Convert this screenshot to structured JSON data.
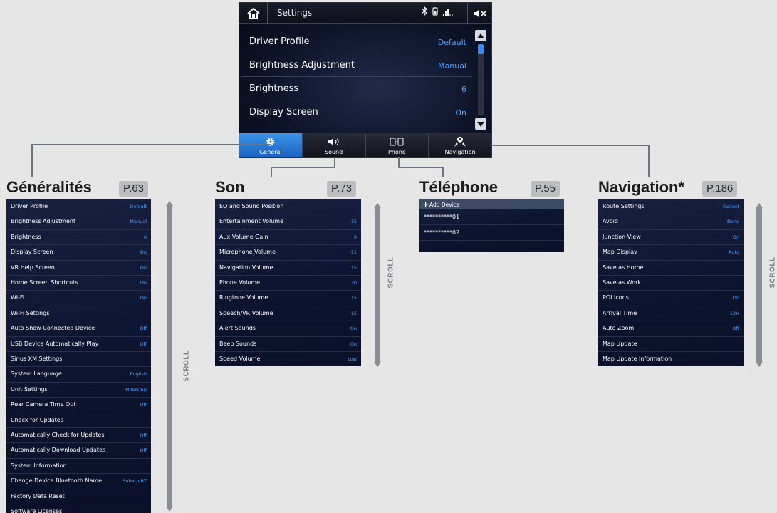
{
  "screen": {
    "title": "Settings",
    "icons": [
      "home-icon",
      "bluetooth-icon",
      "phone-battery-icon",
      "signal-icon",
      "mute-icon"
    ],
    "rows": [
      {
        "label": "Driver Profile",
        "value": "Default"
      },
      {
        "label": "Brightness Adjustment",
        "value": "Manual"
      },
      {
        "label": "Brightness",
        "value": "6"
      },
      {
        "label": "Display Screen",
        "value": "On"
      }
    ],
    "tabs": [
      {
        "label": "General",
        "icon": "gear-icon",
        "active": true
      },
      {
        "label": "Sound",
        "icon": "speaker-icon",
        "active": false
      },
      {
        "label": "Phone",
        "icon": "phone-icon",
        "active": false
      },
      {
        "label": "Navigation",
        "icon": "map-pin-icon",
        "active": false
      }
    ],
    "accent": "#2f80d9",
    "value_color": "#4ea3ff"
  },
  "sections": {
    "general": {
      "title": "Généralités",
      "page_ref": "P.63",
      "scroll_label": "SCROLL",
      "items": [
        {
          "label": "Driver Profile",
          "value": "Default"
        },
        {
          "label": "Brightness Adjustment",
          "value": "Manual"
        },
        {
          "label": "Brightness",
          "value": "6"
        },
        {
          "label": "Display Screen",
          "value": "On"
        },
        {
          "label": "VR Help Screen",
          "value": "On"
        },
        {
          "label": "Home Screen Shortcuts",
          "value": "On"
        },
        {
          "label": "Wi-Fi",
          "value": "On"
        },
        {
          "label": "Wi-Fi Settings",
          "value": ""
        },
        {
          "label": "Auto Show Connected Device",
          "value": "Off"
        },
        {
          "label": "USB Device Automatically Play",
          "value": "Off"
        },
        {
          "label": "Sirius XM Settings",
          "value": ""
        },
        {
          "label": "System Language",
          "value": "English"
        },
        {
          "label": "Unit Settings",
          "value": "Miles(mi)"
        },
        {
          "label": "Rear Camera Time Out",
          "value": "Off"
        },
        {
          "label": "Check for Updates",
          "value": ""
        },
        {
          "label": "Automatically Check for Updates",
          "value": "Off"
        },
        {
          "label": "Automatically Download Updates",
          "value": "Off"
        },
        {
          "label": "System Information",
          "value": ""
        },
        {
          "label": "Change Device Bluetooth Name",
          "value": "Subaru BT"
        },
        {
          "label": "Factory Data Reset",
          "value": ""
        },
        {
          "label": "Software Licenses",
          "value": ""
        }
      ]
    },
    "sound": {
      "title": "Son",
      "page_ref": "P.73",
      "scroll_label": "SCROLL",
      "items": [
        {
          "label": "EQ and Sound Position",
          "value": ""
        },
        {
          "label": "Entertainment Volume",
          "value": "15"
        },
        {
          "label": "Aux Volume Gain",
          "value": "0"
        },
        {
          "label": "Microphone Volume",
          "value": "-11"
        },
        {
          "label": "Navigation Volume",
          "value": "15"
        },
        {
          "label": "Phone Volume",
          "value": "30"
        },
        {
          "label": "Ringtone Volume",
          "value": "15"
        },
        {
          "label": "Speech/VR Volume",
          "value": "15"
        },
        {
          "label": "Alert Sounds",
          "value": "On"
        },
        {
          "label": "Beep Sounds",
          "value": "On"
        },
        {
          "label": "Speed Volume",
          "value": "Low"
        }
      ]
    },
    "phone": {
      "title": "Téléphone",
      "page_ref": "P.55",
      "add_label": "Add Device",
      "devices": [
        "**********01",
        "**********02"
      ]
    },
    "navigation": {
      "title": "Navigation*",
      "page_ref": "P.186",
      "scroll_label": "SCROLL",
      "items": [
        {
          "label": "Route Settings",
          "value": "Fastest"
        },
        {
          "label": "Avoid",
          "value": "None"
        },
        {
          "label": "Junction View",
          "value": "On"
        },
        {
          "label": "Map Display",
          "value": "Auto"
        },
        {
          "label": "Save as Home",
          "value": ""
        },
        {
          "label": "Save as Work",
          "value": ""
        },
        {
          "label": "POI Icons",
          "value": "On"
        },
        {
          "label": "Arrival Time",
          "value": "12H"
        },
        {
          "label": "Auto Zoom",
          "value": "Off"
        },
        {
          "label": "Map Update",
          "value": ""
        },
        {
          "label": "Map Update Information",
          "value": ""
        }
      ]
    }
  }
}
